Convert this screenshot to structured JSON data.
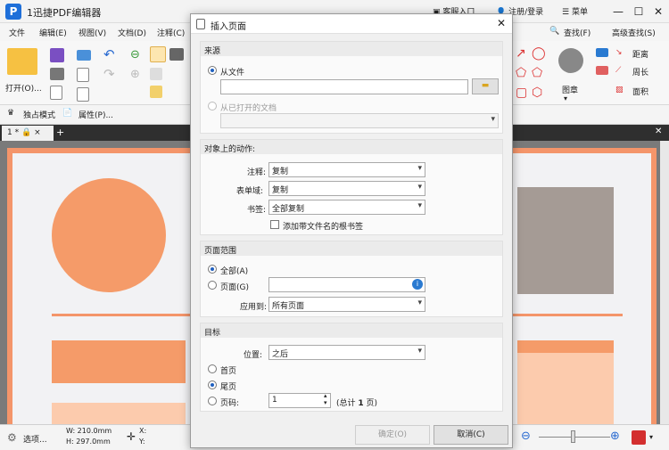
{
  "app": {
    "title": "1迅捷PDF编辑器",
    "customer_service": "客服入口",
    "login": "注册/登录",
    "menu": "菜单"
  },
  "menubar": [
    "文件",
    "编辑(E)",
    "视图(V)",
    "文档(D)",
    "注释(C)"
  ],
  "ribbon": {
    "open_label": "打开(O)...",
    "find_label": "查找(F)",
    "adv_find_label": "高级查找(S)",
    "stamp_label": "图章",
    "distance_label": "距离",
    "perimeter_label": "周长",
    "area_label": "面积"
  },
  "toolbar2": {
    "exclusive_mode": "独占模式",
    "properties": "属性(P)..."
  },
  "tab": {
    "label": "1 *"
  },
  "status": {
    "options": "选项...",
    "width": "W: 210.0mm",
    "height": "H: 297.0mm",
    "x_label": "X:",
    "y_label": "Y:"
  },
  "dialog": {
    "title": "插入页面",
    "source": {
      "header": "来源",
      "from_file": "从文件",
      "from_open_doc": "从已打开的文档"
    },
    "actions": {
      "header": "对象上的动作:",
      "annotations_label": "注释:",
      "annotations_value": "复制",
      "forms_label": "表单域:",
      "forms_value": "复制",
      "bookmarks_label": "书签:",
      "bookmarks_value": "全部复制",
      "add_bookmark_label": "添加带文件名的根书签"
    },
    "page_range": {
      "header": "页面范围",
      "all": "全部(A)",
      "pages": "页面(G)",
      "apply_label": "应用到:",
      "apply_value": "所有页面"
    },
    "target": {
      "header": "目标",
      "position_label": "位置:",
      "position_value": "之后",
      "first": "首页",
      "last": "尾页",
      "page_no": "页码:",
      "page_value": "1",
      "total_prefix": "(总计",
      "total_value": "1",
      "total_suffix": "页)"
    },
    "ok": "确定(O)",
    "cancel": "取消(C)"
  },
  "colors": {
    "accent": "#f4956a",
    "circle": "#f59b69",
    "gray_box": "#a59b95",
    "peach": "#fccbad"
  }
}
